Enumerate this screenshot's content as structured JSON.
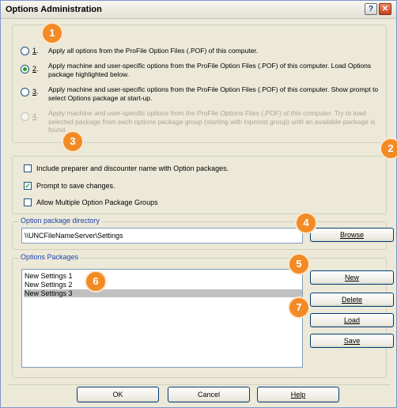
{
  "window": {
    "title": "Options Administration",
    "help_glyph": "?",
    "close_glyph": "✕"
  },
  "load_options": {
    "items": [
      {
        "num": "1",
        "label": "Apply all options from the ProFile Option Files (.POF) of this computer.",
        "selected": false,
        "enabled": true
      },
      {
        "num": "2",
        "label": "Apply machine and user-specific options from the ProFile Option Files (.POF) of this computer. Load Options package highlighted below.",
        "selected": true,
        "enabled": true
      },
      {
        "num": "3",
        "label": "Apply machine and user-specific options from the ProFile Option Files (.POF) of this computer. Show prompt to select Options package at start-up.",
        "selected": false,
        "enabled": true
      },
      {
        "num": "4",
        "label": "Apply machine and user-specific options from the ProFile Options Files (.POF) of this computer. Try to load selected package from each options package group (starting with topmost group) until an available package is found.",
        "selected": false,
        "enabled": false
      }
    ]
  },
  "checkboxes": [
    {
      "label": "Include preparer and discounter name with Option packages.",
      "checked": false
    },
    {
      "label": "Prompt to save changes.",
      "checked": true
    },
    {
      "label": "Allow Multiple Option Package Groups",
      "checked": false
    }
  ],
  "directory": {
    "legend": "Option package directory",
    "value": "\\\\UNCFileNameServer\\Settings",
    "browse_label": "Browse"
  },
  "packages": {
    "legend": "Options Packages",
    "items": [
      "New Settings 1",
      "New Settings 2",
      "New Settings 3"
    ],
    "selected_index": 2,
    "buttons": {
      "new": "New",
      "delete": "Delete",
      "load": "Load",
      "save": "Save"
    }
  },
  "footer": {
    "ok": "OK",
    "cancel": "Cancel",
    "help": "Help"
  },
  "badges": [
    "1",
    "2",
    "3",
    "4",
    "5",
    "6",
    "7"
  ],
  "colors": {
    "badge": "#f28b26",
    "accent": "#1f44ad",
    "selection": "#c0c0c0"
  }
}
